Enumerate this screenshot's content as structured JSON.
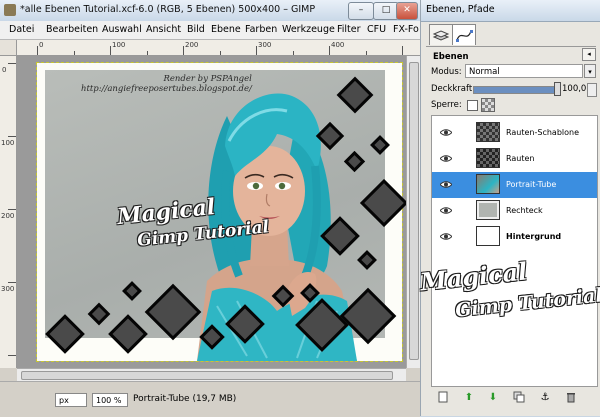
{
  "window": {
    "title": "*alle Ebenen Tutorial.xcf-6.0 (RGB, 5 Ebenen) 500x400 – GIMP",
    "min_label": "–",
    "max_label": "□",
    "close_label": "✕"
  },
  "menu": [
    "Datei",
    "Bearbeiten",
    "Auswahl",
    "Ansicht",
    "Bild",
    "Ebene",
    "Farben",
    "Werkzeuge",
    "Filter",
    "CFU",
    "FX-Fo"
  ],
  "rulers": {
    "top_ticks": [
      "0",
      "100",
      "200",
      "300",
      "400"
    ],
    "left_ticks": [
      "0",
      "100",
      "200",
      "300"
    ]
  },
  "canvas": {
    "credit_line1": "Render by PSPAngel",
    "credit_line2": "http://angiefreeposertubes.blogspot.de/",
    "watermark_line1": "Magical",
    "watermark_line2": "Gimp Tutorial",
    "overlay_wm_line1": "Magical",
    "overlay_wm_line2": "Gimp Tutorial"
  },
  "statusbar": {
    "unit": "px",
    "zoom": "100 %",
    "status": "Portrait-Tube (19,7 MB)"
  },
  "dock": {
    "title": "Ebenen, Pfade",
    "section": "Ebenen",
    "mode_label": "Modus:",
    "mode_value": "Normal",
    "opacity_label": "Deckkraft:",
    "opacity_value": "100,0",
    "opacity_fraction": 1.0,
    "lock_label": "Sperre:"
  },
  "layers": [
    {
      "name": "Rauten-Schablone",
      "thumb": "diamond-pattern",
      "selected": false
    },
    {
      "name": "Rauten",
      "thumb": "diamond-pattern",
      "selected": false
    },
    {
      "name": "Portrait-Tube",
      "thumb": "portrait",
      "selected": true
    },
    {
      "name": "Rechteck",
      "thumb": "rectangle",
      "selected": false
    },
    {
      "name": "Hintergrund",
      "thumb": "white",
      "selected": false
    }
  ],
  "colors": {
    "selection": "#3b8ee0",
    "hair": "#27b3c2",
    "diamond_fill": "#4a4a4a",
    "diamond_border": "#050505"
  }
}
